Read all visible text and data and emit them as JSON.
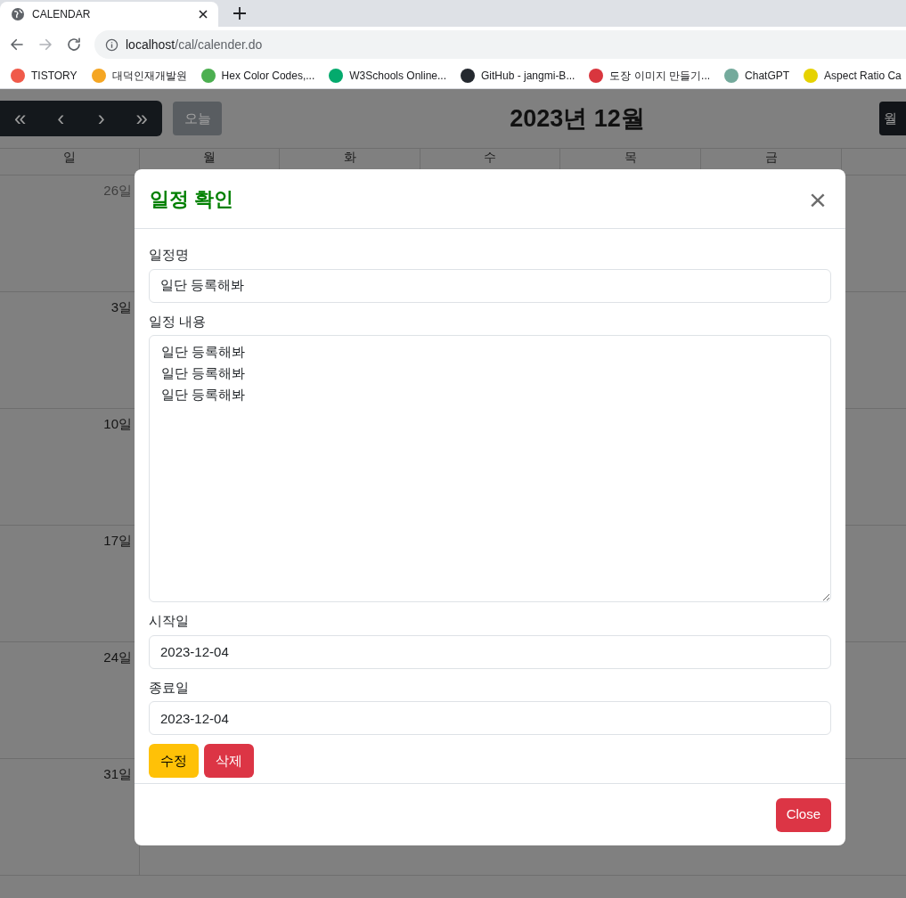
{
  "browser": {
    "tab_title": "CALENDAR",
    "url_host": "localhost",
    "url_path": "/cal/calender.do",
    "bookmarks": [
      {
        "label": "TISTORY",
        "color": "#f05a4a"
      },
      {
        "label": "대덕인재개발원",
        "color": "#f5a623"
      },
      {
        "label": "Hex Color Codes,...",
        "color": "#4caf50"
      },
      {
        "label": "W3Schools Online...",
        "color": "#04aa6d"
      },
      {
        "label": "GitHub - jangmi-B...",
        "color": "#24292f"
      },
      {
        "label": "도장 이미지 만들기...",
        "color": "#d9363e"
      },
      {
        "label": "ChatGPT",
        "color": "#74aa9c"
      },
      {
        "label": "Aspect Ratio Ca",
        "color": "#e6d200"
      }
    ]
  },
  "toolbar": {
    "nav_buttons": [
      "«",
      "‹",
      "›",
      "»"
    ],
    "today_button": "오늘",
    "title": "2023년 12월",
    "view_button": "월"
  },
  "calendar": {
    "weekdays": [
      "일",
      "월",
      "화",
      "수",
      "목",
      "금"
    ],
    "rows": [
      {
        "day": "26일",
        "muted": true
      },
      {
        "day": "3일",
        "muted": false
      },
      {
        "day": "10일",
        "muted": false
      },
      {
        "day": "17일",
        "muted": false
      },
      {
        "day": "24일",
        "muted": false
      },
      {
        "day": "31일",
        "muted": false
      }
    ]
  },
  "modal": {
    "title": "일정 확인",
    "close_symbol": "×",
    "fields": [
      {
        "kind": "input",
        "label": "일정명",
        "value": "일단 등록해봐"
      },
      {
        "kind": "textarea",
        "label": "일정 내용",
        "value": "일단 등록해봐\n일단 등록해봐\n일단 등록해봐"
      },
      {
        "kind": "input",
        "label": "시작일",
        "value": "2023-12-04"
      },
      {
        "kind": "input",
        "label": "종료일",
        "value": "2023-12-04"
      }
    ],
    "actions": [
      {
        "label": "수정",
        "kind": "warning"
      },
      {
        "label": "삭제",
        "kind": "danger"
      }
    ],
    "footer_button": "Close"
  }
}
